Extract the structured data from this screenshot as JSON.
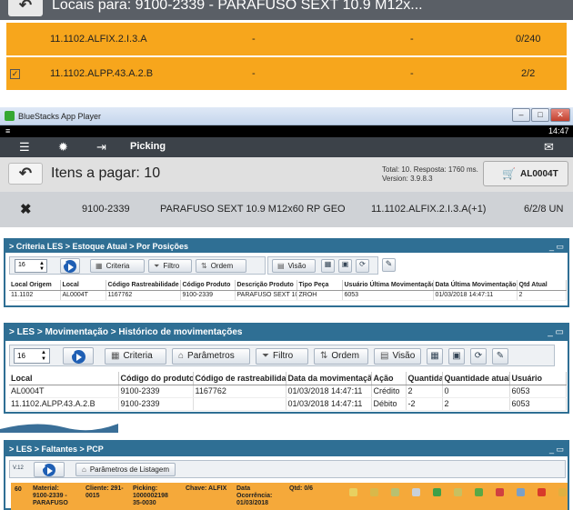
{
  "locais": {
    "back_icon": "back-arrow-icon",
    "title": "Locais para: 9100-2339 - PARAFUSO SEXT 10.9 M12x...",
    "rows": [
      {
        "local": "11.1102.ALFIX.2.I.3.A",
        "c1": "-",
        "c2": "-",
        "qty": "0/240",
        "checked": false
      },
      {
        "local": "11.1102.ALPP.43.A.2.B",
        "c1": "-",
        "c2": "-",
        "qty": "2/2",
        "checked": true
      }
    ]
  },
  "bluestacks": {
    "window_title": "BlueStacks App Player",
    "win_buttons": [
      "–",
      "□",
      "✕"
    ],
    "clock": "14:47",
    "app_title": "Picking",
    "screen_title": "Itens a pagar: 10",
    "info_line1": "Total: 10. Resposta: 1760 ms.",
    "info_line2": "Version: 3.9.8.3",
    "user_button": "AL0004T",
    "item": {
      "codigo": "9100-2339",
      "descricao": "PARAFUSO SEXT 10.9 M12x60 RP GEO",
      "local": "11.1102.ALFIX.2.I.3.A(+1)",
      "qty": "6/2/8 UN"
    }
  },
  "estoque": {
    "breadcrumb": "> Criteria LES > Estoque Atual > Por Posições",
    "window_controls": "_ ▭",
    "page_size": "16",
    "buttons": {
      "criteria": "Criteria",
      "filtro": "Filtro",
      "ordem": "Ordem",
      "visao": "Visão"
    },
    "columns": [
      "Local Origem",
      "Local",
      "Código Rastreabilidade",
      "Código Produto",
      "Descrição Produto",
      "Tipo Peça",
      "Usuário Última Movimentação",
      "Data Última Movimentação",
      "Qtd Atual"
    ],
    "rows": [
      [
        "11.1102",
        "AL0004T",
        "1167762",
        "9100-2339",
        "PARAFUSO SEXT 10.9",
        "ZROH",
        "6053",
        "01/03/2018 14:47:11",
        "2"
      ]
    ]
  },
  "historico": {
    "breadcrumb": "> LES > Movimentação > Histórico de movimentações",
    "window_controls": "_ ▭",
    "page_size": "16",
    "buttons": {
      "criteria": "Criteria",
      "parametros": "Parâmetros",
      "filtro": "Filtro",
      "ordem": "Ordem",
      "visao": "Visão"
    },
    "columns": [
      "Local",
      "Código do produto",
      "Código de rastreabilidade",
      "Data da movimentação",
      "Ação",
      "Quantidade",
      "Quantidade atual",
      "Usuário"
    ],
    "rows": [
      [
        "AL0004T",
        "9100-2339",
        "1167762",
        "01/03/2018 14:47:11",
        "Crédito",
        "2",
        "0",
        "6053"
      ],
      [
        "11.1102.ALPP.43.A.2.B",
        "9100-2339",
        "",
        "01/03/2018 14:47:11",
        "Débito",
        "-2",
        "2",
        "6053"
      ]
    ]
  },
  "faltantes": {
    "breadcrumb": "> LES > Faltantes > PCP",
    "window_controls": "_ ▭",
    "version_tag": "V.12",
    "params_button": "Parâmetros de Listagem",
    "row": {
      "num": "60",
      "material": "Material:\n9100-2339 -\nPARAFUSO",
      "cliente": "Cliente: 291-\n0015",
      "picking": "Picking:\n1000002198\n35-0030",
      "chave": "Chave: ALFIX",
      "data": "Data\nOcorrência:\n01/03/2018",
      "qtd": "Qtd: 0/6"
    },
    "action_icon_colors": [
      "#e8d060",
      "#d9b84a",
      "#b8c070",
      "#c8d0d8",
      "#3fa048",
      "#c8c060",
      "#5aa845",
      "#d04040",
      "#7aa0c8",
      "#d83a2a",
      "#e0b040"
    ]
  }
}
